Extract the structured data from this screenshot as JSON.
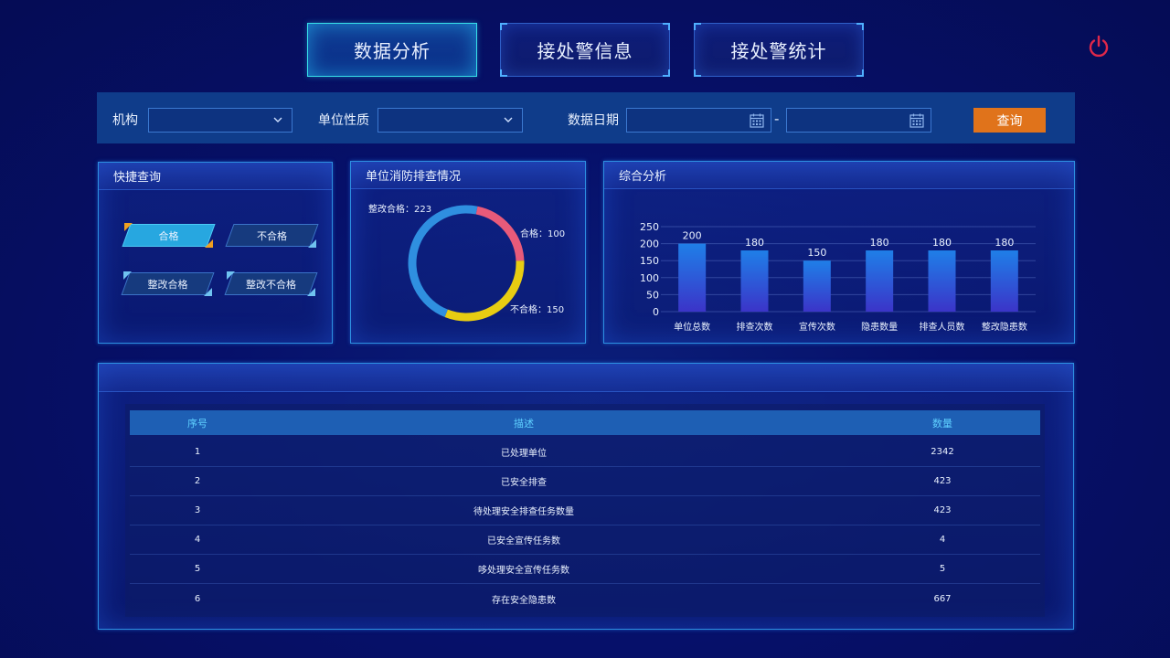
{
  "tabs": [
    {
      "label": "数据分析",
      "active": true
    },
    {
      "label": "接处警信息",
      "active": false
    },
    {
      "label": "接处警统计",
      "active": false
    }
  ],
  "power_icon": "power-icon",
  "filters": {
    "org_label": "机构",
    "org_value": "",
    "unit_type_label": "单位性质",
    "unit_type_value": "",
    "date_label": "数据日期",
    "date_start": "",
    "date_end": "",
    "date_separator": "-",
    "query_label": "查询"
  },
  "quick_query": {
    "title": "快捷查询",
    "buttons": [
      "合格",
      "不合格",
      "整改合格",
      "整改不合格"
    ]
  },
  "inspection": {
    "title": "单位消防排查情况",
    "segments": [
      {
        "label": "整改合格",
        "value": 223,
        "display": "整改合格：223",
        "color": "#2f8fe0"
      },
      {
        "label": "合格",
        "value": 100,
        "display": "合格：100",
        "color": "#e85a7a"
      },
      {
        "label": "不合格",
        "value": 150,
        "display": "不合格：150",
        "color": "#e8cc12"
      }
    ]
  },
  "chart_data": {
    "type": "bar",
    "title": "综合分析",
    "categories": [
      "单位总数",
      "排查次数",
      "宣传次数",
      "隐患数量",
      "排查人员数",
      "整改隐患数"
    ],
    "values": [
      200,
      180,
      150,
      180,
      180,
      180
    ],
    "ylim": [
      0,
      250
    ],
    "yticks": [
      0,
      50,
      100,
      150,
      200,
      250
    ],
    "grid": true
  },
  "table": {
    "headers": [
      "序号",
      "描述",
      "数量"
    ],
    "rows": [
      [
        "1",
        "已处理单位",
        "2342"
      ],
      [
        "2",
        "已安全排查",
        "423"
      ],
      [
        "3",
        "待处理安全排查任务数量",
        "423"
      ],
      [
        "4",
        "已安全宣传任务数",
        "4"
      ],
      [
        "5",
        "哆处理安全宣传任务数",
        "5"
      ],
      [
        "6",
        "存在安全隐患数",
        "667"
      ]
    ]
  },
  "colors": {
    "accent": "#37e0e8",
    "button": "#e0731b",
    "power": "#e0284a"
  }
}
